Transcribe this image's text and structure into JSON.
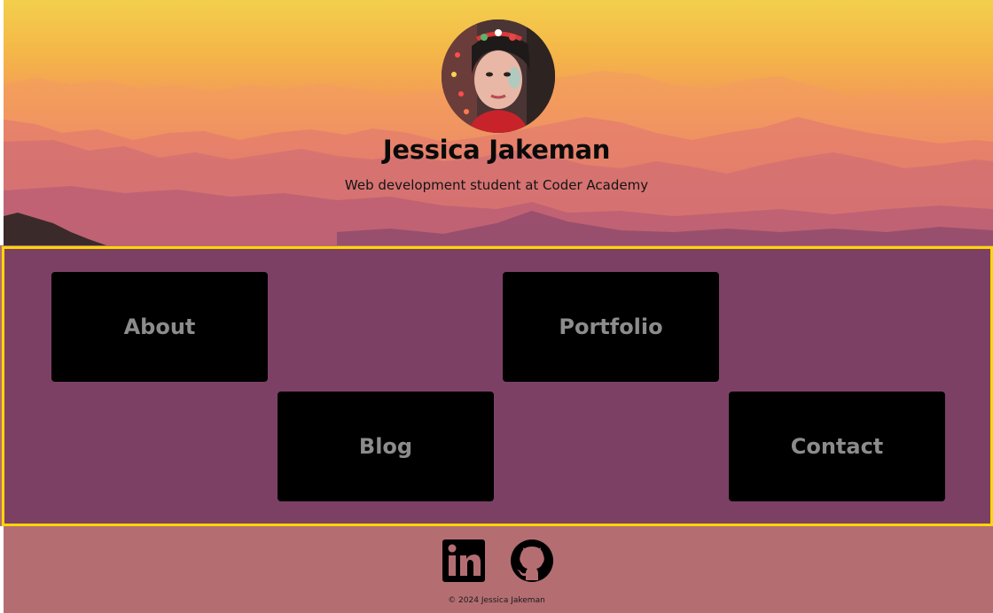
{
  "header": {
    "name": "Jessica Jakeman",
    "tagline": "Web development student at Coder Academy"
  },
  "nav": {
    "tiles": [
      {
        "label": "About"
      },
      {
        "label": "Portfolio"
      },
      {
        "label": "Blog"
      },
      {
        "label": "Contact"
      }
    ]
  },
  "footer": {
    "social": [
      {
        "icon": "linkedin-icon"
      },
      {
        "icon": "github-icon"
      }
    ],
    "copyright": "© 2024 Jessica Jakeman"
  },
  "colors": {
    "nav_background": "#7d4065",
    "nav_border": "#ffd600",
    "tile_background": "#000000",
    "tile_text": "#8c8c8c",
    "footer_background": "#b46e72"
  }
}
